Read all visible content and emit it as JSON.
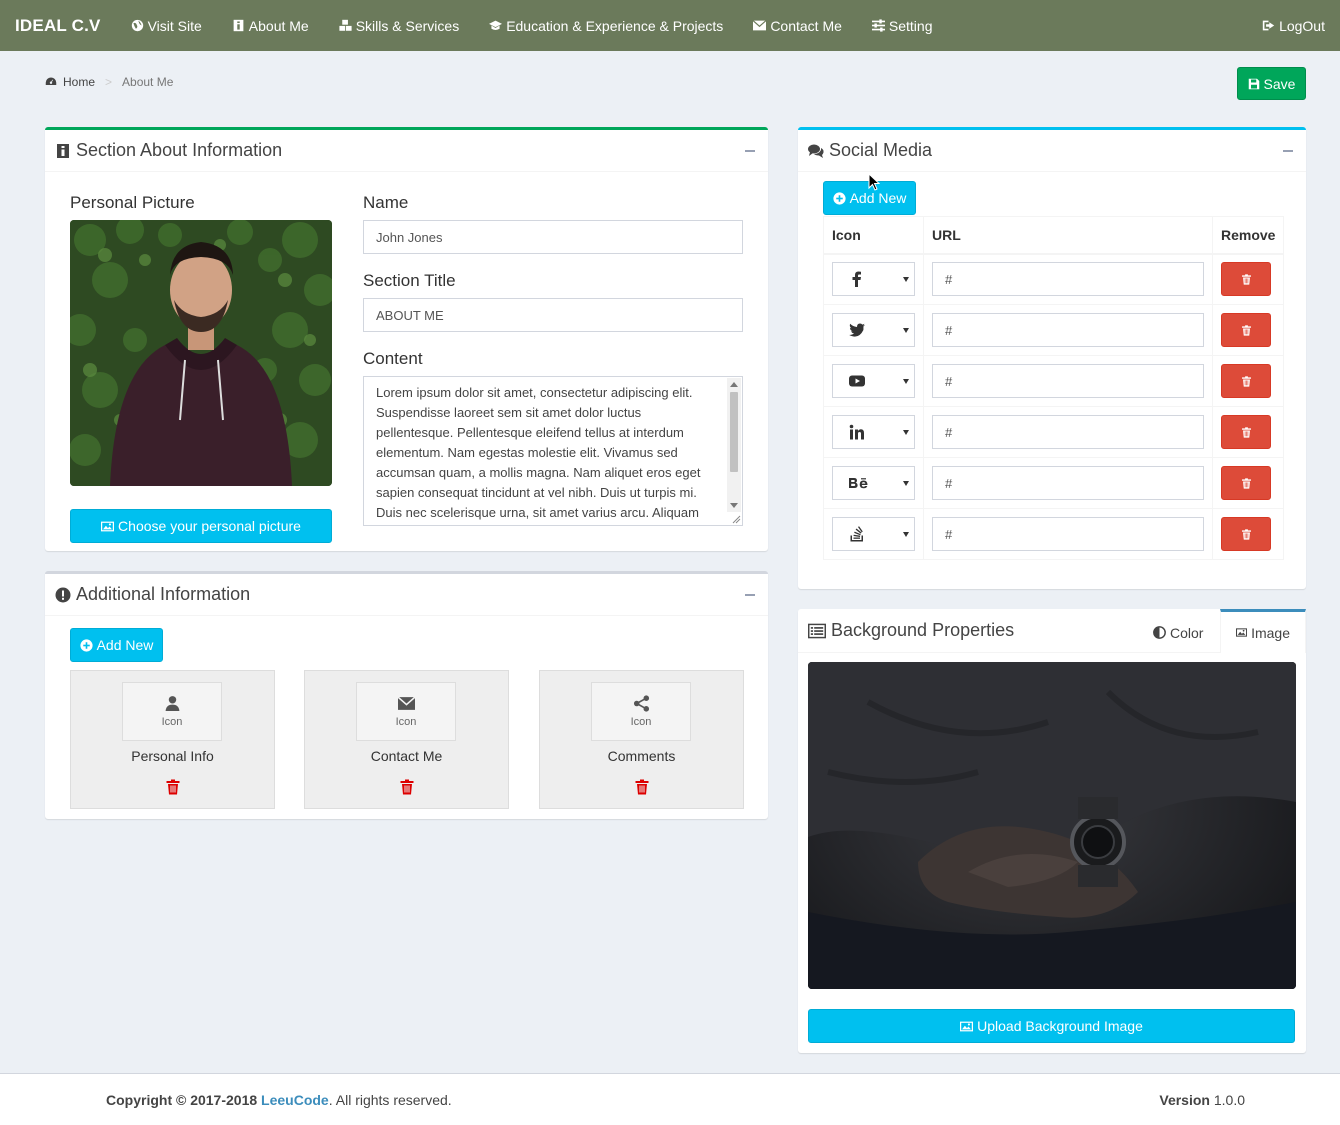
{
  "navbar": {
    "brand": "IDEAL C.V",
    "items": [
      {
        "label": "Visit Site",
        "icon": "globe-icon"
      },
      {
        "label": "About Me",
        "icon": "info-icon"
      },
      {
        "label": "Skills & Services",
        "icon": "cubes-icon"
      },
      {
        "label": "Education & Experience & Projects",
        "icon": "graduation-cap-icon"
      },
      {
        "label": "Contact Me",
        "icon": "envelope-icon"
      },
      {
        "label": "Setting",
        "icon": "sliders-icon"
      }
    ],
    "logout": "LogOut"
  },
  "breadcrumb": {
    "home": "Home",
    "current": "About Me"
  },
  "save_label": "Save",
  "about_section": {
    "title": "Section About Information",
    "picture_label": "Personal Picture",
    "choose_picture": "Choose your personal picture",
    "name_label": "Name",
    "name_value": "John Jones",
    "section_title_label": "Section Title",
    "section_title_value": "ABOUT ME",
    "content_label": "Content",
    "content_value": "Lorem ipsum dolor sit amet, consectetur adipiscing elit. Suspendisse laoreet sem sit amet dolor luctus pellentesque. Pellentesque eleifend tellus at interdum elementum. Nam egestas molestie elit. Vivamus sed accumsan quam, a mollis magna. Nam aliquet eros eget sapien consequat tincidunt at vel nibh. Duis ut turpis mi. Duis nec scelerisque urna, sit amet varius arcu. Aliquam"
  },
  "additional_info": {
    "title": "Additional Information",
    "add_new": "Add New",
    "icon_label": "Icon",
    "cards": [
      {
        "title": "Personal Info",
        "icon": "user-icon"
      },
      {
        "title": "Contact Me",
        "icon": "envelope-icon"
      },
      {
        "title": "Comments",
        "icon": "share-icon"
      }
    ]
  },
  "social_media": {
    "title": "Social Media",
    "add_new": "Add New",
    "columns": [
      "Icon",
      "URL",
      "Remove"
    ],
    "rows": [
      {
        "icon": "facebook-icon",
        "url": "#"
      },
      {
        "icon": "twitter-icon",
        "url": "#"
      },
      {
        "icon": "youtube-icon",
        "url": "#"
      },
      {
        "icon": "linkedin-icon",
        "url": "#"
      },
      {
        "icon": "behance-icon",
        "url": "#"
      },
      {
        "icon": "stack-overflow-icon",
        "url": "#"
      }
    ]
  },
  "background": {
    "title": "Background Properties",
    "tab_color": "Color",
    "tab_image": "Image",
    "active_tab": "Image",
    "upload": "Upload Background Image"
  },
  "footer": {
    "copyright_prefix": "Copyright © 2017-2018",
    "company": "LeeuCode",
    "suffix": ". All rights reserved.",
    "version_label": "Version",
    "version": "1.0.0"
  },
  "colors": {
    "navbar": "#6b7a5b",
    "success": "#00a65a",
    "info": "#00c0ef",
    "danger": "#dd4b39",
    "link": "#3c8dbc"
  }
}
